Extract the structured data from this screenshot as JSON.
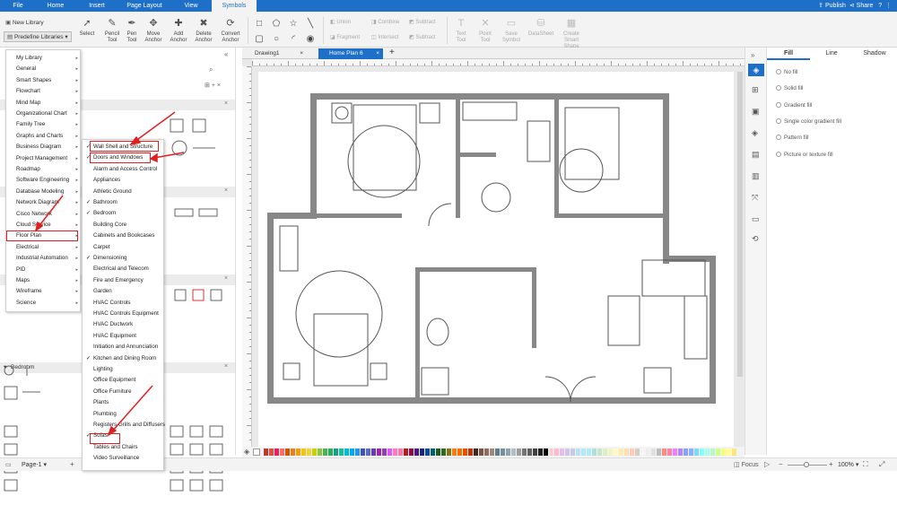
{
  "menubar": {
    "items": [
      "File",
      "Home",
      "Insert",
      "Page Layout",
      "View",
      "Symbols"
    ],
    "active": "Symbols",
    "publish_label": "Publish",
    "share_label": "Share"
  },
  "toolbar": {
    "new_library": "New Library",
    "predefine_libraries": "Predefine Libraries",
    "tools": [
      "Select",
      "Pencil Tool",
      "Pen Tool",
      "Move Anchor",
      "Add Anchor",
      "Delete Anchor",
      "Convert Anchor"
    ],
    "disabled": [
      "Union",
      "Combine",
      "Subtract",
      "Fragment",
      "Intersect",
      "Subtract"
    ],
    "text_tools": [
      "Text Tool",
      "Point Tool",
      "Save Symbol",
      "DataSheet",
      "Create Smart Shape"
    ]
  },
  "top_menu": [
    {
      "label": "My Library",
      "arrow": true
    },
    {
      "label": "General",
      "arrow": true
    },
    {
      "label": "Smart Shapes",
      "arrow": true
    },
    {
      "label": "Flowchart",
      "arrow": true
    },
    {
      "label": "Mind Map",
      "arrow": true
    },
    {
      "label": "Organizational Chart",
      "arrow": true
    },
    {
      "label": "Family Tree",
      "arrow": true
    },
    {
      "label": "Graphs and Charts",
      "arrow": true
    },
    {
      "label": "Business Diagram",
      "arrow": true
    },
    {
      "label": "Project Management",
      "arrow": true
    },
    {
      "label": "Roadmap",
      "arrow": true
    },
    {
      "label": "Software Engineering",
      "arrow": true
    },
    {
      "label": "Database Modeling",
      "arrow": true
    },
    {
      "label": "Network Diagram",
      "arrow": true
    },
    {
      "label": "Cisco Network",
      "arrow": true
    },
    {
      "label": "Cloud Service",
      "arrow": true
    },
    {
      "label": "Floor Plan",
      "arrow": true
    },
    {
      "label": "Electrical",
      "arrow": true
    },
    {
      "label": "Industrial Automation",
      "arrow": true
    },
    {
      "label": "PID",
      "arrow": true
    },
    {
      "label": "Maps",
      "arrow": true
    },
    {
      "label": "Wireframe",
      "arrow": true
    },
    {
      "label": "Science",
      "arrow": true
    }
  ],
  "sub_menu": [
    {
      "label": "Wall Shell and Structure",
      "checked": true
    },
    {
      "label": "Doors and Windows",
      "checked": true
    },
    {
      "label": "Alarm and Access Control",
      "checked": false
    },
    {
      "label": "Appliances",
      "checked": false
    },
    {
      "label": "Athletic Ground",
      "checked": false
    },
    {
      "label": "Bathroom",
      "checked": true
    },
    {
      "label": "Bedroom",
      "checked": true
    },
    {
      "label": "Building Core",
      "checked": false
    },
    {
      "label": "Cabinets and Bookcases",
      "checked": false
    },
    {
      "label": "Carpet",
      "checked": false
    },
    {
      "label": "Dimensioning",
      "checked": true
    },
    {
      "label": "Electrical and Telecom",
      "checked": false
    },
    {
      "label": "Fire and Emergency",
      "checked": false
    },
    {
      "label": "Garden",
      "checked": false
    },
    {
      "label": "HVAC Controls",
      "checked": false
    },
    {
      "label": "HVAC Controls Equipment",
      "checked": false
    },
    {
      "label": "HVAC Ductwork",
      "checked": false
    },
    {
      "label": "HVAC Equipment",
      "checked": false
    },
    {
      "label": "Initiation and Annunciation",
      "checked": false
    },
    {
      "label": "Kitchen and Dining Room",
      "checked": true
    },
    {
      "label": "Lighting",
      "checked": false
    },
    {
      "label": "Office Equipment",
      "checked": false
    },
    {
      "label": "Office Furniture",
      "checked": false
    },
    {
      "label": "Plants",
      "checked": false
    },
    {
      "label": "Plumbing",
      "checked": false
    },
    {
      "label": "Registers Grills and Diffusers",
      "checked": false
    },
    {
      "label": "Sofas",
      "checked": true
    },
    {
      "label": "Tables and Chairs",
      "checked": false
    },
    {
      "label": "Video Surveillance",
      "checked": false
    }
  ],
  "left_panel": {
    "section_bedroom": "Bedroom"
  },
  "tabs": {
    "items": [
      "Drawing1",
      "Home Plan 6"
    ],
    "active": "Home Plan 6"
  },
  "right_panel": {
    "tabs": [
      "Fill",
      "Line",
      "Shadow"
    ],
    "active": "Fill",
    "options": [
      "No fill",
      "Solid fill",
      "Gradient fill",
      "Single color gradient fill",
      "Pattern fill",
      "Picture or texture fill"
    ]
  },
  "status": {
    "page": "Page-1",
    "focus": "Focus",
    "zoom": "100%"
  },
  "palette": [
    "#c0392b",
    "#e74c3c",
    "#e91e63",
    "#ff6f61",
    "#d35400",
    "#e67e22",
    "#f39c12",
    "#f1c40f",
    "#f4d03f",
    "#c9d200",
    "#8bc34a",
    "#4caf50",
    "#27ae60",
    "#16a085",
    "#1abc9c",
    "#00bcd4",
    "#03a9f4",
    "#2196f3",
    "#3f51b5",
    "#5c6bc0",
    "#673ab7",
    "#9c27b0",
    "#8e44ad",
    "#e056fd",
    "#ff79c6",
    "#fd79a8",
    "#b71c1c",
    "#880e4f",
    "#4a148c",
    "#1a237e",
    "#0d47a1",
    "#006064",
    "#1b5e20",
    "#33691e",
    "#827717",
    "#f57f17",
    "#ff6f00",
    "#e65100",
    "#bf360c",
    "#3e2723",
    "#795548",
    "#8d6e63",
    "#a1887f",
    "#607d8b",
    "#78909c",
    "#90a4ae",
    "#b0bec5",
    "#9e9e9e",
    "#757575",
    "#616161",
    "#424242",
    "#212121",
    "#000000",
    "#ffcdd2",
    "#f8bbd0",
    "#e1bee7",
    "#d1c4e9",
    "#c5cae9",
    "#bbdefb",
    "#b3e5fc",
    "#b2ebf2",
    "#b2dfdb",
    "#c8e6c9",
    "#dcedc8",
    "#f0f4c3",
    "#fff9c4",
    "#ffecb3",
    "#ffe0b2",
    "#ffccbc",
    "#d7ccc8",
    "#f5f5f5",
    "#eeeeee",
    "#e0e0e0",
    "#bdbdbd",
    "#ff8a80",
    "#ff80ab",
    "#ea80fc",
    "#b388ff",
    "#8c9eff",
    "#82b1ff",
    "#80d8ff",
    "#84ffff",
    "#a7ffeb",
    "#b9f6ca",
    "#ccff90",
    "#f4ff81",
    "#ffff8d",
    "#ffe57f",
    "#ffd180",
    "#ff9e80"
  ]
}
